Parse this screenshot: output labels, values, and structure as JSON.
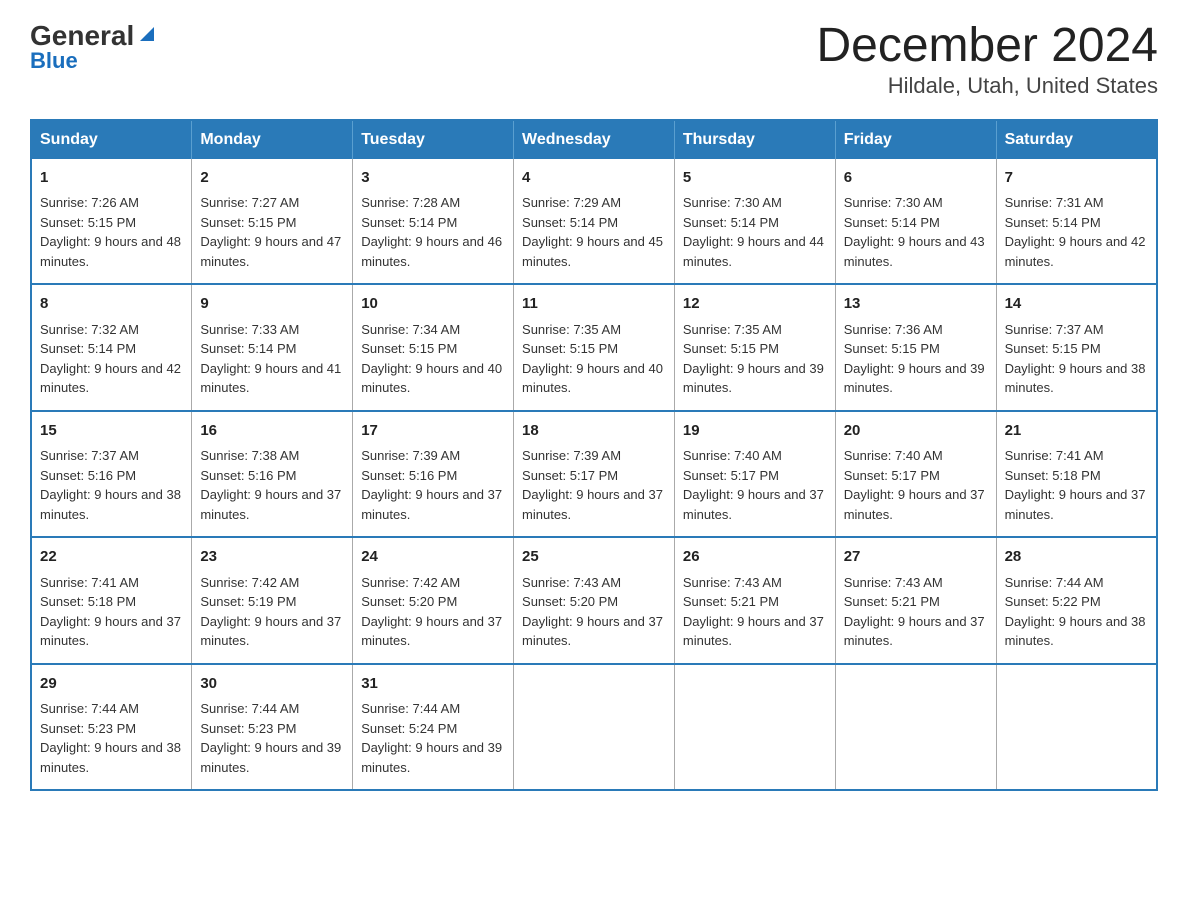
{
  "logo": {
    "general": "General",
    "triangle": "▲",
    "blue": "Blue"
  },
  "header": {
    "month_year": "December 2024",
    "location": "Hildale, Utah, United States"
  },
  "days_of_week": [
    "Sunday",
    "Monday",
    "Tuesday",
    "Wednesday",
    "Thursday",
    "Friday",
    "Saturday"
  ],
  "weeks": [
    [
      {
        "day": "1",
        "sunrise": "7:26 AM",
        "sunset": "5:15 PM",
        "daylight": "9 hours and 48 minutes."
      },
      {
        "day": "2",
        "sunrise": "7:27 AM",
        "sunset": "5:15 PM",
        "daylight": "9 hours and 47 minutes."
      },
      {
        "day": "3",
        "sunrise": "7:28 AM",
        "sunset": "5:14 PM",
        "daylight": "9 hours and 46 minutes."
      },
      {
        "day": "4",
        "sunrise": "7:29 AM",
        "sunset": "5:14 PM",
        "daylight": "9 hours and 45 minutes."
      },
      {
        "day": "5",
        "sunrise": "7:30 AM",
        "sunset": "5:14 PM",
        "daylight": "9 hours and 44 minutes."
      },
      {
        "day": "6",
        "sunrise": "7:30 AM",
        "sunset": "5:14 PM",
        "daylight": "9 hours and 43 minutes."
      },
      {
        "day": "7",
        "sunrise": "7:31 AM",
        "sunset": "5:14 PM",
        "daylight": "9 hours and 42 minutes."
      }
    ],
    [
      {
        "day": "8",
        "sunrise": "7:32 AM",
        "sunset": "5:14 PM",
        "daylight": "9 hours and 42 minutes."
      },
      {
        "day": "9",
        "sunrise": "7:33 AM",
        "sunset": "5:14 PM",
        "daylight": "9 hours and 41 minutes."
      },
      {
        "day": "10",
        "sunrise": "7:34 AM",
        "sunset": "5:15 PM",
        "daylight": "9 hours and 40 minutes."
      },
      {
        "day": "11",
        "sunrise": "7:35 AM",
        "sunset": "5:15 PM",
        "daylight": "9 hours and 40 minutes."
      },
      {
        "day": "12",
        "sunrise": "7:35 AM",
        "sunset": "5:15 PM",
        "daylight": "9 hours and 39 minutes."
      },
      {
        "day": "13",
        "sunrise": "7:36 AM",
        "sunset": "5:15 PM",
        "daylight": "9 hours and 39 minutes."
      },
      {
        "day": "14",
        "sunrise": "7:37 AM",
        "sunset": "5:15 PM",
        "daylight": "9 hours and 38 minutes."
      }
    ],
    [
      {
        "day": "15",
        "sunrise": "7:37 AM",
        "sunset": "5:16 PM",
        "daylight": "9 hours and 38 minutes."
      },
      {
        "day": "16",
        "sunrise": "7:38 AM",
        "sunset": "5:16 PM",
        "daylight": "9 hours and 37 minutes."
      },
      {
        "day": "17",
        "sunrise": "7:39 AM",
        "sunset": "5:16 PM",
        "daylight": "9 hours and 37 minutes."
      },
      {
        "day": "18",
        "sunrise": "7:39 AM",
        "sunset": "5:17 PM",
        "daylight": "9 hours and 37 minutes."
      },
      {
        "day": "19",
        "sunrise": "7:40 AM",
        "sunset": "5:17 PM",
        "daylight": "9 hours and 37 minutes."
      },
      {
        "day": "20",
        "sunrise": "7:40 AM",
        "sunset": "5:17 PM",
        "daylight": "9 hours and 37 minutes."
      },
      {
        "day": "21",
        "sunrise": "7:41 AM",
        "sunset": "5:18 PM",
        "daylight": "9 hours and 37 minutes."
      }
    ],
    [
      {
        "day": "22",
        "sunrise": "7:41 AM",
        "sunset": "5:18 PM",
        "daylight": "9 hours and 37 minutes."
      },
      {
        "day": "23",
        "sunrise": "7:42 AM",
        "sunset": "5:19 PM",
        "daylight": "9 hours and 37 minutes."
      },
      {
        "day": "24",
        "sunrise": "7:42 AM",
        "sunset": "5:20 PM",
        "daylight": "9 hours and 37 minutes."
      },
      {
        "day": "25",
        "sunrise": "7:43 AM",
        "sunset": "5:20 PM",
        "daylight": "9 hours and 37 minutes."
      },
      {
        "day": "26",
        "sunrise": "7:43 AM",
        "sunset": "5:21 PM",
        "daylight": "9 hours and 37 minutes."
      },
      {
        "day": "27",
        "sunrise": "7:43 AM",
        "sunset": "5:21 PM",
        "daylight": "9 hours and 37 minutes."
      },
      {
        "day": "28",
        "sunrise": "7:44 AM",
        "sunset": "5:22 PM",
        "daylight": "9 hours and 38 minutes."
      }
    ],
    [
      {
        "day": "29",
        "sunrise": "7:44 AM",
        "sunset": "5:23 PM",
        "daylight": "9 hours and 38 minutes."
      },
      {
        "day": "30",
        "sunrise": "7:44 AM",
        "sunset": "5:23 PM",
        "daylight": "9 hours and 39 minutes."
      },
      {
        "day": "31",
        "sunrise": "7:44 AM",
        "sunset": "5:24 PM",
        "daylight": "9 hours and 39 minutes."
      },
      null,
      null,
      null,
      null
    ]
  ]
}
